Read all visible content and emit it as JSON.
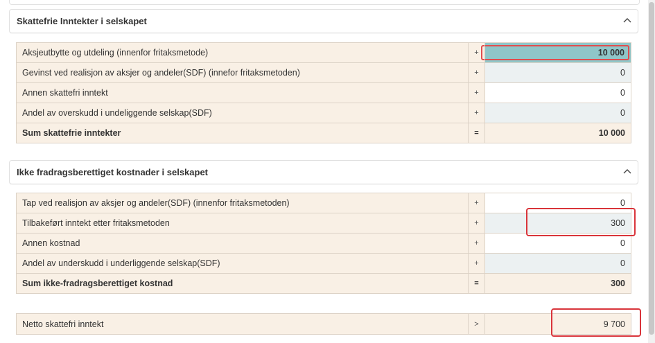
{
  "section1": {
    "title": "Skattefrie Inntekter i selskapet",
    "rows": [
      {
        "label": "Aksjeutbytte og utdeling (innenfor fritaksmetode)",
        "op": "+",
        "value": "10 000"
      },
      {
        "label": "Gevinst ved realisjon av aksjer og andeler(SDF) (innefor fritaksmetoden)",
        "op": "+",
        "value": "0"
      },
      {
        "label": "Annen skattefri inntekt",
        "op": "+",
        "value": "0"
      },
      {
        "label": "Andel av overskudd i undeliggende selskap(SDF)",
        "op": "+",
        "value": "0"
      }
    ],
    "sum": {
      "label": "Sum skattefrie inntekter",
      "op": "=",
      "value": "10 000"
    }
  },
  "section2": {
    "title": "Ikke fradragsberettiget kostnader i selskapet",
    "rows": [
      {
        "label": "Tap ved realisjon av aksjer og andeler(SDF) (innenfor fritaksmetoden)",
        "op": "+",
        "value": "0"
      },
      {
        "label": "Tilbakeført inntekt etter fritaksmetoden",
        "op": "+",
        "value": "300"
      },
      {
        "label": "Annen kostnad",
        "op": "+",
        "value": "0"
      },
      {
        "label": "Andel av underskudd i underliggende selskap(SDF)",
        "op": "+",
        "value": "0"
      }
    ],
    "sum": {
      "label": "Sum ikke-fradragsberettiget kostnad",
      "op": "=",
      "value": "300"
    }
  },
  "netto": {
    "label": "Netto skattefri inntekt",
    "op": ">",
    "value": "9 700"
  },
  "icons": {
    "collapse": "chevron-up-icon"
  },
  "colors": {
    "label_bg": "#f9f0e5",
    "highlight_bg": "#8fc6c8",
    "annotation_red": "#d9343a",
    "alt_value_bg": "#ecf1f2"
  }
}
